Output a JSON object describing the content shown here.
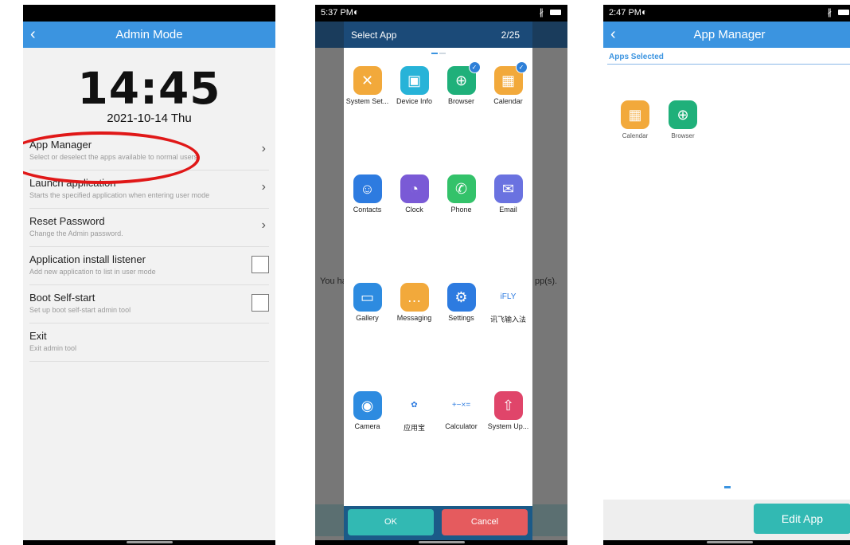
{
  "phone1": {
    "status": {
      "time": "",
      "icons": []
    },
    "title": "Admin Mode",
    "back_icon": "back-arrow-icon",
    "clock": "14:45",
    "date": "2021-10-14 Thu",
    "menu": [
      {
        "title": "App Manager",
        "subtitle": "Select or deselect the apps available to normal users.",
        "control": "chevron"
      },
      {
        "title": "Launch application",
        "subtitle": "Starts the specified application when entering user mode",
        "control": "chevron"
      },
      {
        "title": "Reset Password",
        "subtitle": "Change the Admin password.",
        "control": "chevron"
      },
      {
        "title": "Application install listener",
        "subtitle": "Add new application to list in user mode",
        "control": "checkbox"
      },
      {
        "title": "Boot Self-start",
        "subtitle": "Set up boot self-start admin tool",
        "control": "checkbox"
      },
      {
        "title": "Exit",
        "subtitle": "Exit admin tool",
        "control": "none"
      }
    ],
    "chevron": "›",
    "annotation_color": "#e01818"
  },
  "phone2": {
    "status": {
      "time": "5:37 PM"
    },
    "dialog_title": "Select App",
    "page": "2/25",
    "behind_text_left": "You ha",
    "behind_text_right": "pp(s).",
    "apps": [
      {
        "label": "System Set...",
        "icon": "tools-icon",
        "color": "#f2a93b",
        "glyph": "✕",
        "checked": false
      },
      {
        "label": "Device Info",
        "icon": "chip-icon",
        "color": "#27b3d8",
        "glyph": "▣",
        "checked": false
      },
      {
        "label": "Browser",
        "icon": "globe-icon",
        "color": "#1fb07a",
        "glyph": "⊕",
        "checked": true
      },
      {
        "label": "Calendar",
        "icon": "calendar-icon",
        "color": "#f2a93b",
        "glyph": "▦",
        "checked": true
      },
      {
        "label": "Contacts",
        "icon": "contacts-icon",
        "color": "#2d7be0",
        "glyph": "☺",
        "checked": false
      },
      {
        "label": "Clock",
        "icon": "clock-icon",
        "color": "#7a5ad6",
        "glyph": "◔",
        "checked": false
      },
      {
        "label": "Phone",
        "icon": "phone-icon",
        "color": "#33c26a",
        "glyph": "✆",
        "checked": false
      },
      {
        "label": "Email",
        "icon": "email-icon",
        "color": "#6a72e0",
        "glyph": "✉",
        "checked": false
      },
      {
        "label": "Gallery",
        "icon": "gallery-icon",
        "color": "#2d8be0",
        "glyph": "▭",
        "checked": false
      },
      {
        "label": "Messaging",
        "icon": "message-icon",
        "color": "#f2a93b",
        "glyph": "…",
        "checked": false
      },
      {
        "label": "Settings",
        "icon": "settings-icon",
        "color": "#2d7be0",
        "glyph": "⚙",
        "checked": false
      },
      {
        "label": "讯飞输入法",
        "icon": "ifly-icon",
        "color": "#ffffff",
        "glyph": "iFLY",
        "checked": false
      },
      {
        "label": "Camera",
        "icon": "camera-icon",
        "color": "#2d8be0",
        "glyph": "◉",
        "checked": false
      },
      {
        "label": "应用宝",
        "icon": "app-store-icon",
        "color": "#ffffff",
        "glyph": "✿",
        "checked": false
      },
      {
        "label": "Calculator",
        "icon": "calculator-icon",
        "color": "#ffffff",
        "glyph": "+−×=",
        "checked": false
      },
      {
        "label": "System Up...",
        "icon": "system-update-icon",
        "color": "#e0456a",
        "glyph": "⇧",
        "checked": false
      }
    ],
    "ok_label": "OK",
    "cancel_label": "Cancel"
  },
  "phone3": {
    "status": {
      "time": "2:47 PM"
    },
    "title": "App Manager",
    "section_label": "Apps Selected",
    "apps": [
      {
        "label": "Calendar",
        "icon": "calendar-icon",
        "color": "#f2a93b",
        "glyph": "▦"
      },
      {
        "label": "Browser",
        "icon": "globe-icon",
        "color": "#1fb07a",
        "glyph": "⊕"
      }
    ],
    "edit_label": "Edit App"
  }
}
